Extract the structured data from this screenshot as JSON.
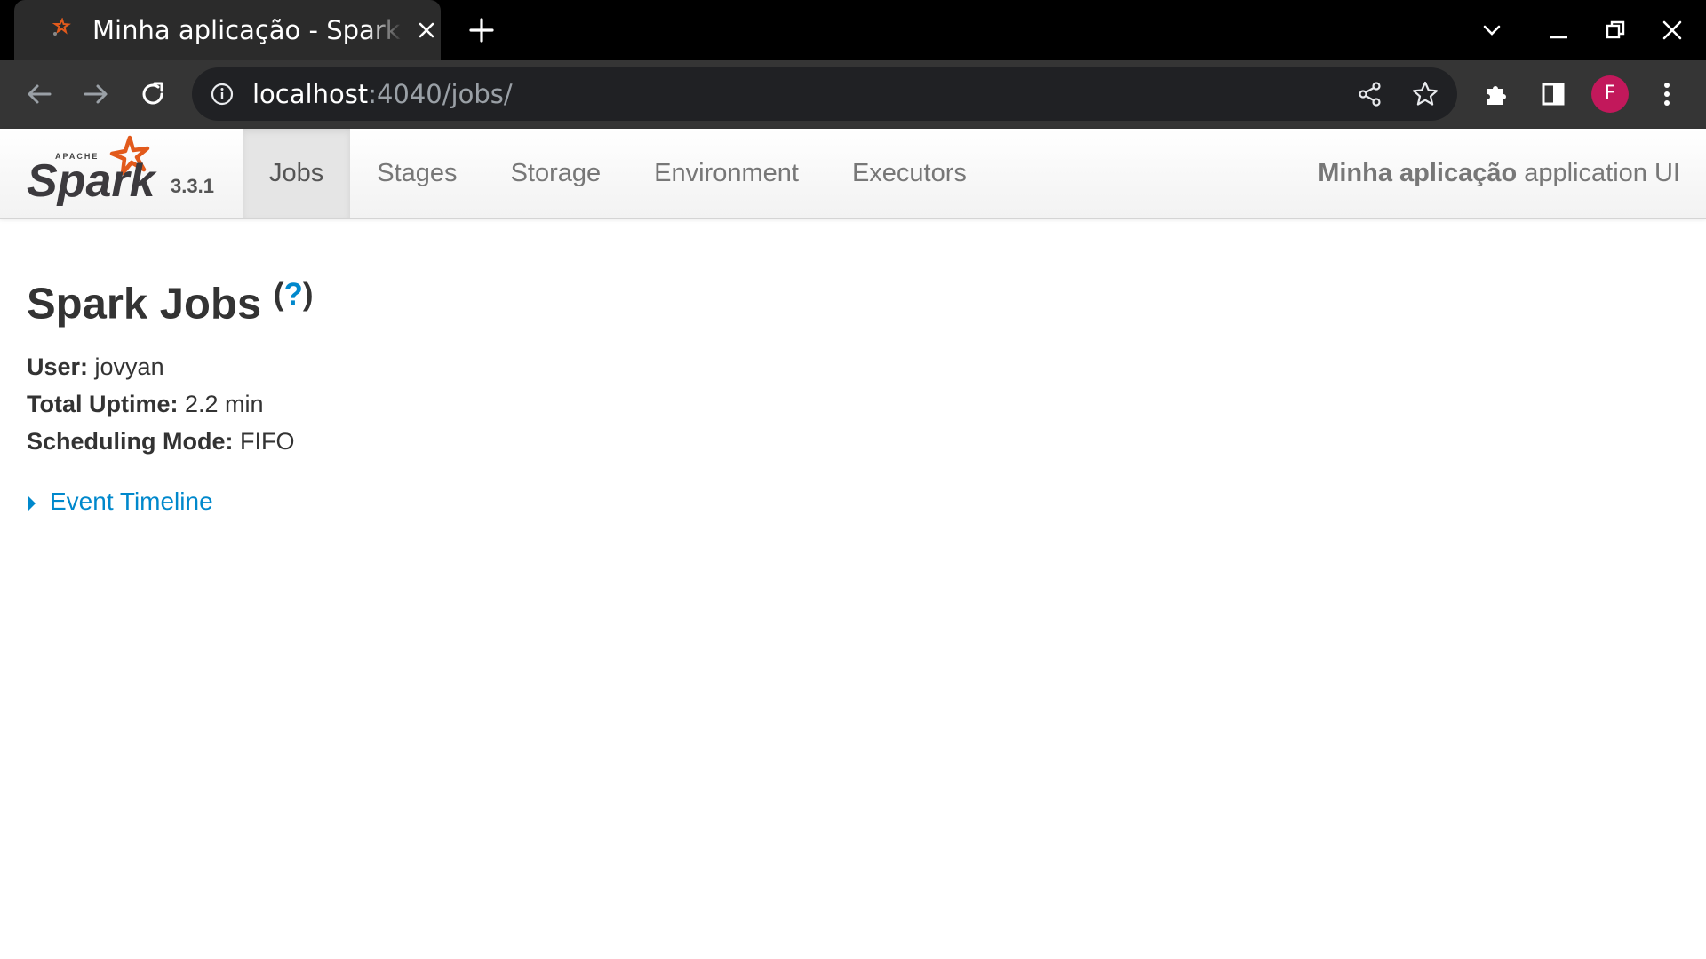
{
  "browser": {
    "tab_title": "Minha aplicação - Spark Jobs",
    "url_host": "localhost",
    "url_path": ":4040/jobs/",
    "profile_initial": "F"
  },
  "navbar": {
    "brand_text": "Spark",
    "brand_apache": "APACHE",
    "version": "3.3.1",
    "items": [
      {
        "label": "Jobs",
        "active": true
      },
      {
        "label": "Stages"
      },
      {
        "label": "Storage"
      },
      {
        "label": "Environment"
      },
      {
        "label": "Executors"
      }
    ],
    "app_name": "Minha aplicação",
    "app_suffix": " application UI"
  },
  "page": {
    "title": "Spark Jobs",
    "help_open": "(",
    "help_mark": "?",
    "help_close": ")",
    "user_label": "User:",
    "user_value": " jovyan",
    "uptime_label": "Total Uptime:",
    "uptime_value": " 2.2 min",
    "mode_label": "Scheduling Mode:",
    "mode_value": " FIFO",
    "timeline_label": "Event Timeline"
  },
  "colors": {
    "link": "#0088cc",
    "avatar": "#c2185b",
    "spark_orange": "#e25a1c"
  }
}
